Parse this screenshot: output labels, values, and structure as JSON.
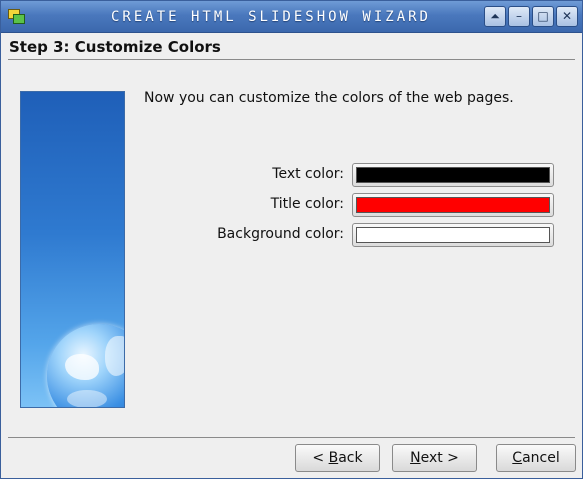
{
  "window": {
    "title": "CREATE HTML SLIDESHOW WIZARD",
    "controls": {
      "shade": "⏶",
      "minimize": "–",
      "maximize": "□",
      "close": "✕"
    }
  },
  "step": {
    "title": "Step 3: Customize Colors"
  },
  "intro_text": "Now you can customize the colors of the web pages.",
  "colors": [
    {
      "label": "Text color:",
      "value": "#000000"
    },
    {
      "label": "Title color:",
      "value": "#ff0000"
    },
    {
      "label": "Background color:",
      "value": "#ffffff"
    }
  ],
  "buttons": {
    "back": {
      "prefix": "< ",
      "mnemonic": "B",
      "rest": "ack"
    },
    "next": {
      "mnemonic": "N",
      "rest": "ext >"
    },
    "cancel": {
      "mnemonic": "C",
      "rest": "ancel"
    }
  },
  "icons": {
    "app": "slideshow-app-icon",
    "side": "globe-image"
  }
}
